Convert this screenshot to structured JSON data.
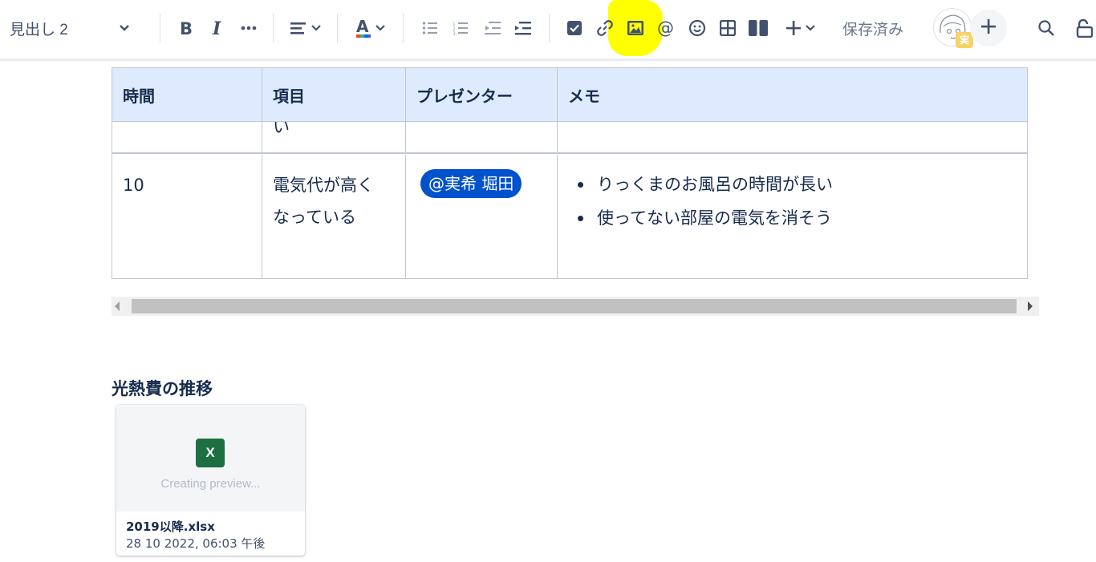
{
  "toolbar": {
    "text_style": "見出し 2",
    "saved_status": "保存済み",
    "avatar_badge": "実",
    "highlight_color": "#ffff00",
    "icons": [
      "chevron-down-icon",
      "bold-icon",
      "italic-icon",
      "more-icon",
      "align-icon",
      "text-color-icon",
      "bullet-list-icon",
      "numbered-list-icon",
      "outdent-icon",
      "indent-icon",
      "task-icon",
      "link-icon",
      "image-icon",
      "mention-icon",
      "emoji-icon",
      "table-icon",
      "layout-icon",
      "insert-plus-icon",
      "search-icon",
      "lock-icon"
    ]
  },
  "table": {
    "headers": [
      "時間",
      "項目",
      "プレゼンター",
      "メモ"
    ],
    "prev_row_fragment": "い",
    "row": {
      "time": "10",
      "item_line1": "電気代が高く",
      "item_line2": "なっている",
      "presenter": "@実希 堀田",
      "memo": [
        "りっくまのお風呂の時間が長い",
        "使ってない部屋の電気を消そう"
      ]
    },
    "header_bg": "#deebff",
    "mention_color": "#0052cc"
  },
  "section": {
    "title": "光熱費の推移"
  },
  "file_card": {
    "icon_letter": "X",
    "preview_text": "Creating preview...",
    "file_name": "2019以降.xlsx",
    "date": "28 10 2022, 06:03 午後",
    "excel_color": "#1d6f42"
  }
}
